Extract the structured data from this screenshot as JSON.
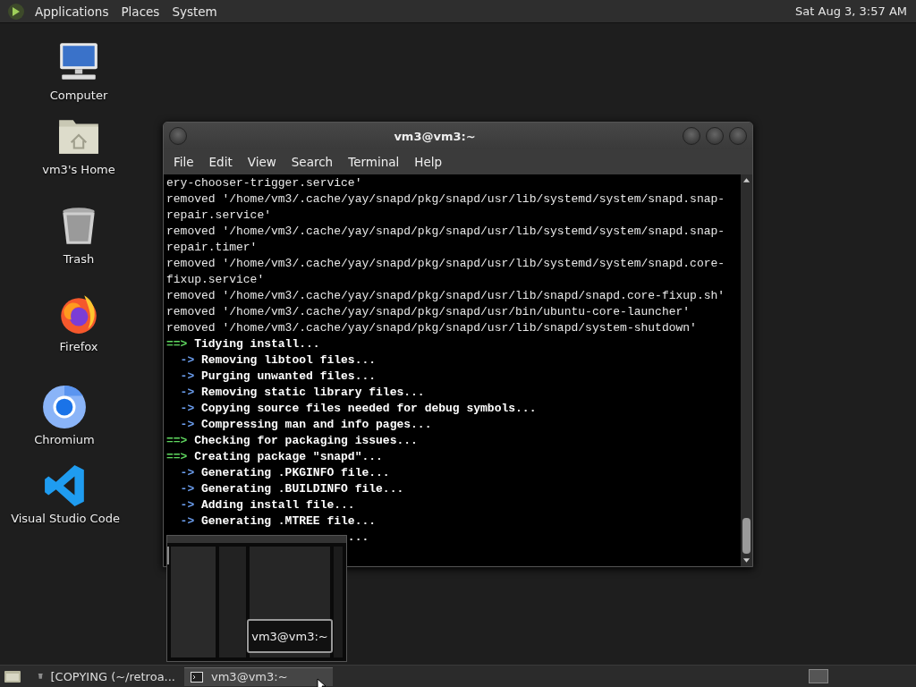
{
  "top_panel": {
    "menus": [
      "Applications",
      "Places",
      "System"
    ],
    "clock": "Sat Aug 3, 3:57 AM"
  },
  "desktop_icons": [
    {
      "kind": "computer",
      "label": "Computer"
    },
    {
      "kind": "home",
      "label": "vm3's Home"
    },
    {
      "kind": "trash",
      "label": "Trash"
    },
    {
      "kind": "firefox",
      "label": "Firefox"
    },
    {
      "kind": "chromium",
      "label": "Chromium"
    },
    {
      "kind": "vscode",
      "label": "Visual Studio Code"
    }
  ],
  "terminal_window": {
    "title": "vm3@vm3:~",
    "menu": [
      "File",
      "Edit",
      "View",
      "Search",
      "Terminal",
      "Help"
    ],
    "lines": [
      {
        "kind": "plain",
        "text": "ery-chooser-trigger.service'"
      },
      {
        "kind": "plain",
        "text": "removed '/home/vm3/.cache/yay/snapd/pkg/snapd/usr/lib/systemd/system/snapd.snap-"
      },
      {
        "kind": "plain",
        "text": "repair.service'"
      },
      {
        "kind": "plain",
        "text": "removed '/home/vm3/.cache/yay/snapd/pkg/snapd/usr/lib/systemd/system/snapd.snap-"
      },
      {
        "kind": "plain",
        "text": "repair.timer'"
      },
      {
        "kind": "plain",
        "text": "removed '/home/vm3/.cache/yay/snapd/pkg/snapd/usr/lib/systemd/system/snapd.core-"
      },
      {
        "kind": "plain",
        "text": "fixup.service'"
      },
      {
        "kind": "plain",
        "text": "removed '/home/vm3/.cache/yay/snapd/pkg/snapd/usr/lib/snapd/snapd.core-fixup.sh'"
      },
      {
        "kind": "plain",
        "text": "removed '/home/vm3/.cache/yay/snapd/pkg/snapd/usr/bin/ubuntu-core-launcher'"
      },
      {
        "kind": "plain",
        "text": "removed '/home/vm3/.cache/yay/snapd/pkg/snapd/usr/lib/snapd/system-shutdown'"
      },
      {
        "kind": "main",
        "prefix": "==>",
        "text": "Tidying install..."
      },
      {
        "kind": "sub",
        "prefix": "->",
        "text": "Removing libtool files..."
      },
      {
        "kind": "sub",
        "prefix": "->",
        "text": "Purging unwanted files..."
      },
      {
        "kind": "sub",
        "prefix": "->",
        "text": "Removing static library files..."
      },
      {
        "kind": "sub",
        "prefix": "->",
        "text": "Copying source files needed for debug symbols..."
      },
      {
        "kind": "sub",
        "prefix": "->",
        "text": "Compressing man and info pages..."
      },
      {
        "kind": "main",
        "prefix": "==>",
        "text": "Checking for packaging issues..."
      },
      {
        "kind": "main",
        "prefix": "==>",
        "text": "Creating package \"snapd\"..."
      },
      {
        "kind": "sub",
        "prefix": "->",
        "text": "Generating .PKGINFO file..."
      },
      {
        "kind": "sub",
        "prefix": "->",
        "text": "Generating .BUILDINFO file..."
      },
      {
        "kind": "sub",
        "prefix": "->",
        "text": "Adding install file..."
      },
      {
        "kind": "sub",
        "prefix": "->",
        "text": "Generating .MTREE file..."
      },
      {
        "kind": "tail",
        "text": "..."
      }
    ]
  },
  "window_preview": {
    "kind": "picture",
    "label": "vm3@vm3:~"
  },
  "taskbar": {
    "tasks": [
      {
        "kind": "file-operation",
        "label": "[COPYING (~/retroa...",
        "selected": false
      },
      {
        "kind": "terminal",
        "label": "vm3@vm3:~",
        "selected": true
      }
    ]
  }
}
